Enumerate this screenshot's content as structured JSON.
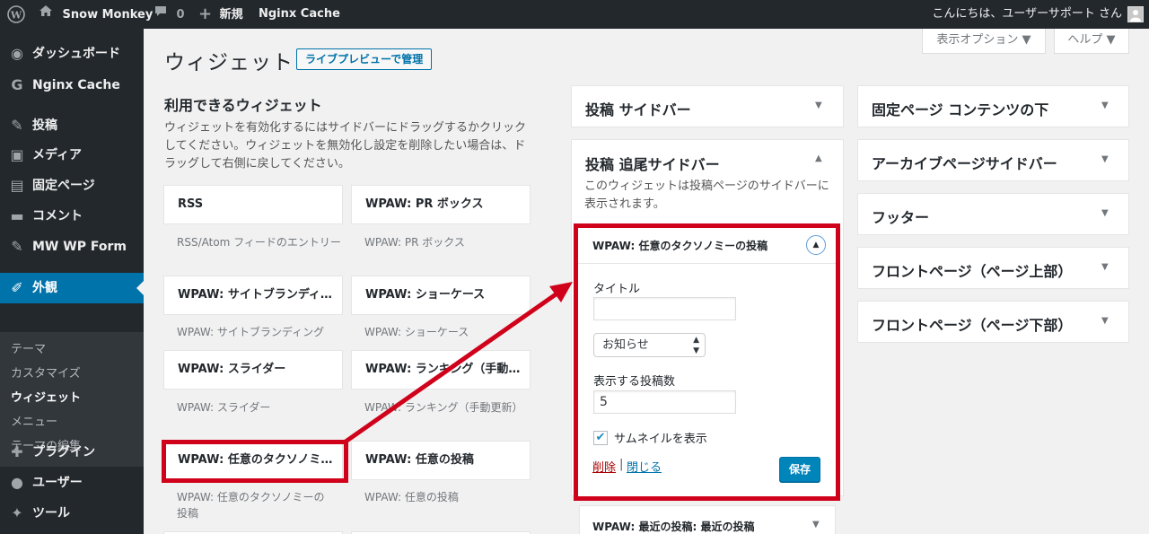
{
  "adminbar": {
    "site_name": "Snow Monkey",
    "comments_count": "0",
    "new_label": "新規",
    "nginx_cache": "Nginx Cache",
    "greeting": "こんにちは、ユーザーサポート さん"
  },
  "sidebar": {
    "items": [
      {
        "label": "ダッシュボード",
        "icon": "dashboard-icon"
      },
      {
        "label": "Nginx Cache",
        "icon": "g-icon"
      },
      {
        "label": "投稿",
        "icon": "pin-icon"
      },
      {
        "label": "メディア",
        "icon": "media-icon"
      },
      {
        "label": "固定ページ",
        "icon": "page-icon"
      },
      {
        "label": "コメント",
        "icon": "comment-icon"
      },
      {
        "label": "MW WP Form",
        "icon": "pin-icon"
      },
      {
        "label": "外観",
        "icon": "brush-icon"
      },
      {
        "label": "プラグイン",
        "icon": "plugin-icon"
      },
      {
        "label": "ユーザー",
        "icon": "user-icon"
      },
      {
        "label": "ツール",
        "icon": "wrench-icon"
      }
    ],
    "submenu": [
      "テーマ",
      "カスタマイズ",
      "ウィジェット",
      "メニュー",
      "テーマの編集"
    ]
  },
  "header": {
    "screen_options": "表示オプション ▼",
    "help": "ヘルプ ▼",
    "title": "ウィジェット",
    "live_preview": "ライブプレビューで管理"
  },
  "available": {
    "heading": "利用できるウィジェット",
    "description": "ウィジェットを有効化するにはサイドバーにドラッグするかクリックしてください。ウィジェットを無効化し設定を削除したい場合は、ドラッグして右側に戻してください。",
    "widgets": [
      {
        "title": "RSS",
        "desc": "RSS/Atom フィードのエントリー"
      },
      {
        "title": "WPAW: PR ボックス",
        "desc": "WPAW: PR ボックス"
      },
      {
        "title": "WPAW: サイトブランディ…",
        "desc": "WPAW: サイトブランディング"
      },
      {
        "title": "WPAW: ショーケース",
        "desc": "WPAW: ショーケース"
      },
      {
        "title": "WPAW: スライダー",
        "desc": "WPAW: スライダー"
      },
      {
        "title": "WPAW: ランキング（手動…",
        "desc": "WPAW: ランキング（手動更新）"
      },
      {
        "title": "WPAW: 任意のタクソノミ…",
        "desc": "WPAW: 任意のタクソノミーの投稿"
      },
      {
        "title": "WPAW: 任意の投稿",
        "desc": "WPAW: 任意の投稿"
      }
    ]
  },
  "middle": {
    "sidebar1": "投稿 サイドバー",
    "sidebar2": "投稿 追尾サイドバー",
    "sidebar2_desc": "このウィジェットは投稿ページのサイドバーに表示されます。",
    "widget": {
      "title": "WPAW: 任意のタクソノミーの投稿",
      "title_label": "タイトル",
      "title_value": "",
      "select_value": "お知らせ",
      "count_label": "表示する投稿数",
      "count_value": "5",
      "thumbnail_label": "サムネイルを表示",
      "thumbnail_checked": true,
      "delete": "削除",
      "separator": "|",
      "close": "閉じる",
      "save": "保存"
    },
    "recent_widget": "WPAW: 最近の投稿: 最近の投稿"
  },
  "right": {
    "areas": [
      "固定ページ コンテンツの下",
      "アーカイブページサイドバー",
      "フッター",
      "フロントページ（ページ上部）",
      "フロントページ（ページ下部）"
    ]
  },
  "colors": {
    "accent": "#0073aa",
    "highlight": "#d0021b",
    "adminbar": "#23282d"
  }
}
